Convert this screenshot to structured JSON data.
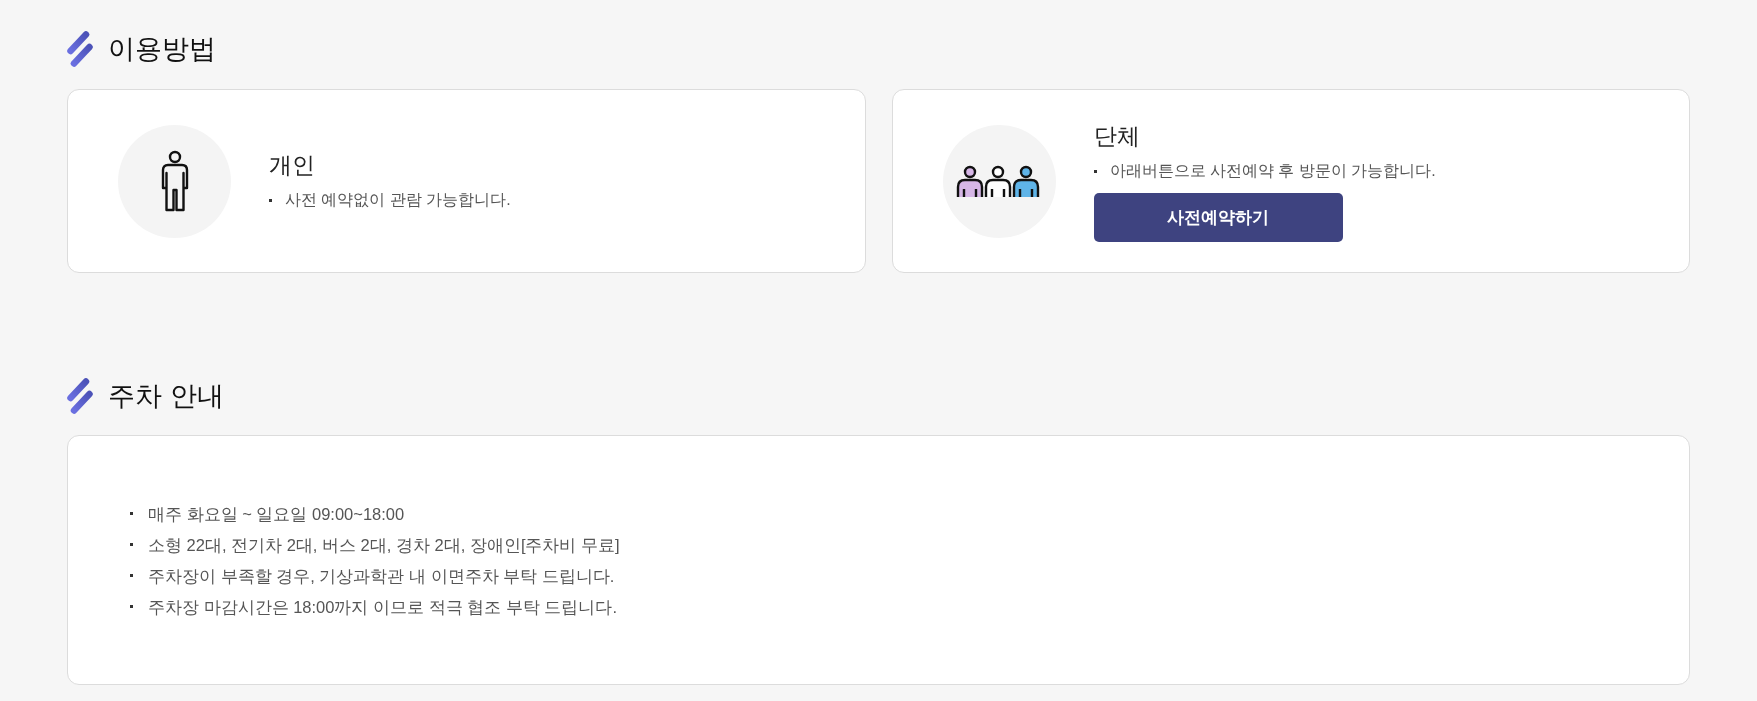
{
  "sections": [
    {
      "title": "이용방법",
      "kind": "cards",
      "cards": [
        {
          "kind": "individual",
          "title": "개인",
          "notes": [
            "사전 예약없이 관람 가능합니다."
          ]
        },
        {
          "kind": "group",
          "title": "단체",
          "notes": [
            "아래버튼으로 사전예약 후 방문이 가능합니다."
          ],
          "button": "사전예약하기"
        }
      ]
    },
    {
      "title": "주차 안내",
      "kind": "list",
      "items": [
        "매주 화요일 ~ 일요일 09:00~18:00",
        "소형 22대, 전기차 2대, 버스 2대, 경차 2대, 장애인[주차비 무료]",
        "주차장이 부족할 경우, 기상과학관 내 이면주차 부탁 드립니다.",
        "주차장 마감시간은 18:00까지 이므로 적극 협조 부탁 드립니다."
      ]
    }
  ]
}
